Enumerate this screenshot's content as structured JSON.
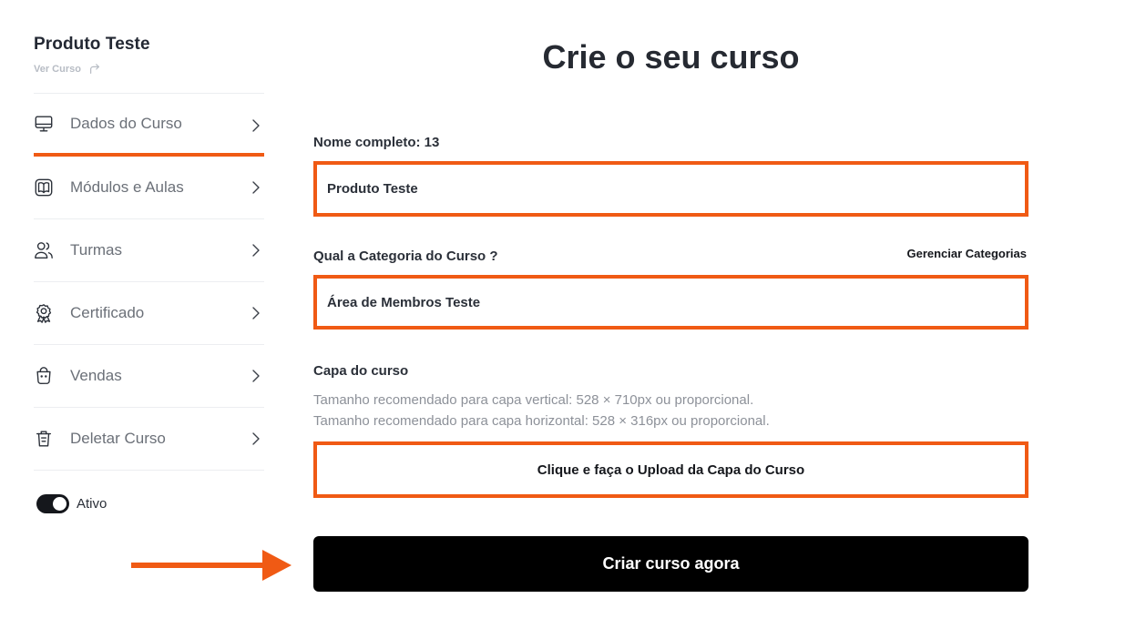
{
  "sidebar": {
    "product_title": "Produto Teste",
    "view_course_label": "Ver Curso",
    "items": [
      {
        "label": "Dados do Curso",
        "icon": "monitor-icon"
      },
      {
        "label": "Módulos e Aulas",
        "icon": "book-icon"
      },
      {
        "label": "Turmas",
        "icon": "users-icon"
      },
      {
        "label": "Certificado",
        "icon": "award-icon"
      },
      {
        "label": "Vendas",
        "icon": "shopping-bag-icon"
      },
      {
        "label": "Deletar Curso",
        "icon": "trash-icon"
      }
    ],
    "active_index": 0,
    "toggle_label": "Ativo",
    "toggle_on": true
  },
  "main": {
    "title": "Crie o seu curso",
    "name_field": {
      "label": "Nome completo: 13",
      "value": "Produto Teste"
    },
    "category_field": {
      "label": "Qual a Categoria do Curso ?",
      "value": "Área de Membros Teste",
      "manage_link": "Gerenciar Categorias"
    },
    "cover": {
      "label": "Capa do curso",
      "hint_vertical": "Tamanho recomendado para capa vertical: 528 × 710px ou proporcional.",
      "hint_horizontal": "Tamanho recomendado para capa horizontal: 528 × 316px ou proporcional.",
      "upload_label": "Clique e faça o Upload da Capa do Curso"
    },
    "submit_label": "Criar curso agora"
  },
  "colors": {
    "accent": "#f05a14",
    "button": "#000000",
    "text": "#1f2430",
    "muted": "#8d9199"
  }
}
